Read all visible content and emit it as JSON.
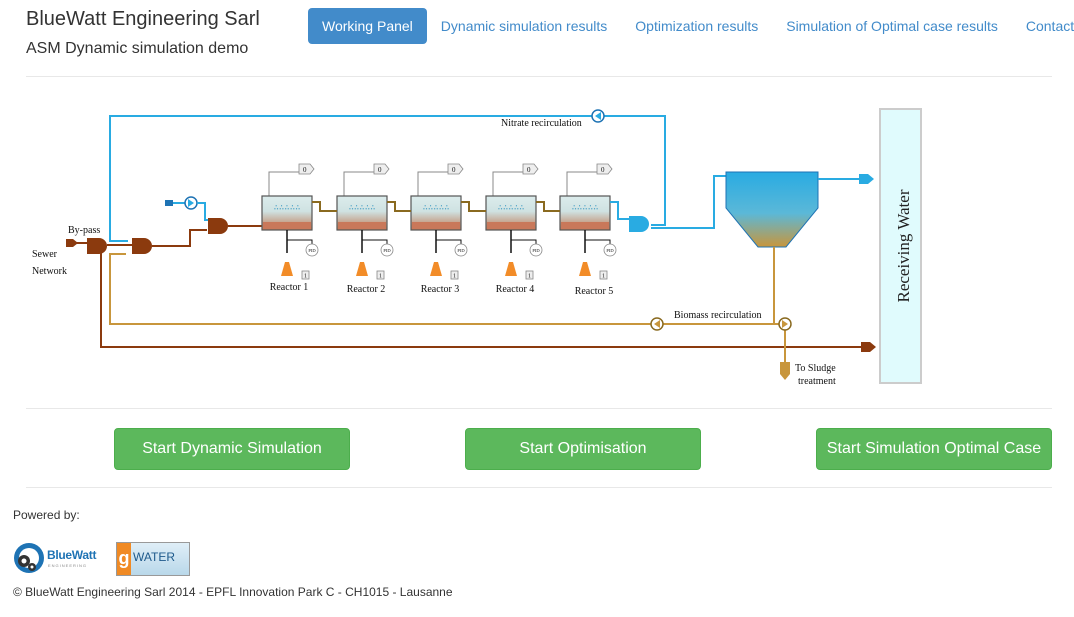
{
  "header": {
    "title": "BlueWatt Engineering Sarl",
    "subtitle": "ASM Dynamic simulation demo"
  },
  "nav": {
    "items": [
      {
        "label": "Working Panel",
        "active": true
      },
      {
        "label": "Dynamic simulation results",
        "active": false
      },
      {
        "label": "Optimization results",
        "active": false
      },
      {
        "label": "Simulation of Optimal case results",
        "active": false
      },
      {
        "label": "Contact",
        "active": false
      }
    ]
  },
  "diagram": {
    "sewer_line1": "Sewer",
    "sewer_line2": "Network",
    "bypass": "By-pass",
    "nitrate_recirculation": "Nitrate recirculation",
    "biomass_recirculation": "Biomass recirculation",
    "sludge_line1": "To Sludge",
    "sludge_line2": "treatment",
    "receiving_water": "Receiving Water",
    "reactors": [
      "Reactor 1",
      "Reactor 2",
      "Reactor 3",
      "Reactor 4",
      "Reactor 5"
    ],
    "sensor_labels": {
      "output": "0",
      "controller": "PID",
      "input": "1"
    },
    "colors": {
      "water": "#29abe2",
      "wastewater": "#8b3a0e",
      "sludge": "#c8963c",
      "pump": "#f28c28",
      "receiving_water_fill": "#e0fbfd"
    }
  },
  "actions": {
    "start_dynamic": "Start Dynamic Simulation",
    "start_optimisation": "Start Optimisation",
    "start_optimal": "Start Simulation Optimal Case"
  },
  "footer": {
    "powered_by": "Powered by:",
    "bluewatt_logo": "BlueWatt",
    "bluewatt_logo_sub": "ENGINEERING",
    "gwater_logo_g": "g",
    "gwater_logo_text": "WATER",
    "copyright": "© BlueWatt Engineering Sarl 2014 - EPFL Innovation Park C - CH1015 - Lausanne"
  }
}
